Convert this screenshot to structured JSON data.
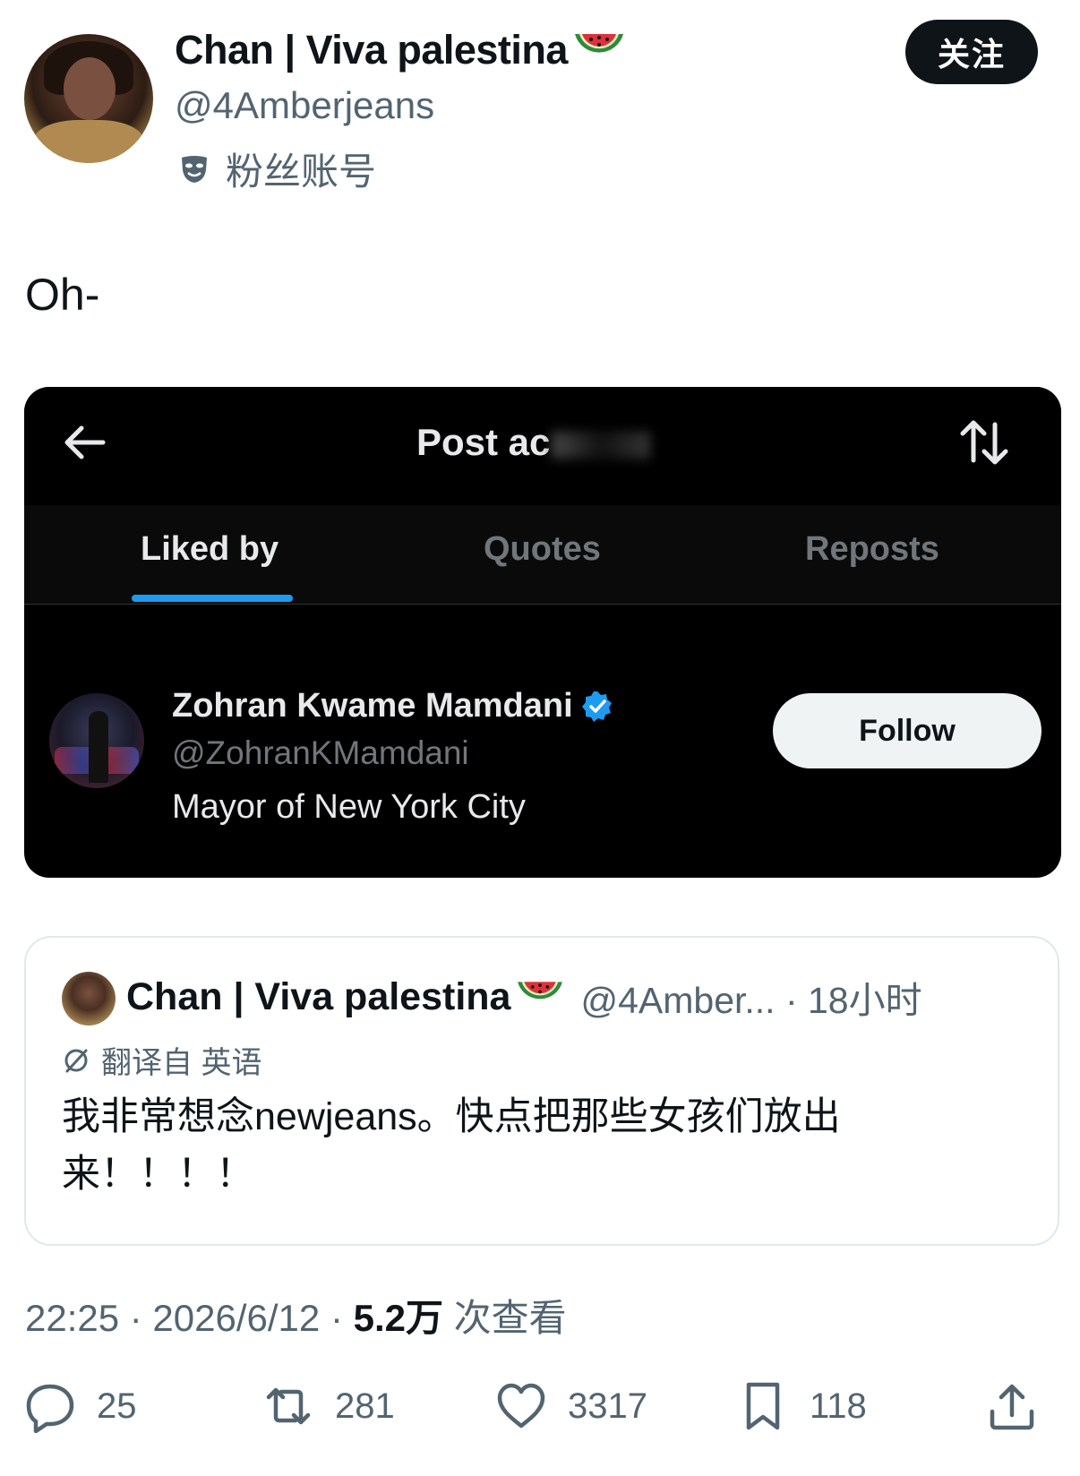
{
  "author": {
    "display_name": "Chan | Viva palestina",
    "handle": "@4Amberjeans",
    "account_label": "粉丝账号"
  },
  "follow_button": "关注",
  "tweet_text": "Oh-",
  "embedded": {
    "title": "Post ac",
    "tabs": [
      {
        "label": "Liked by",
        "active": true
      },
      {
        "label": "Quotes",
        "active": false
      },
      {
        "label": "Reposts",
        "active": false
      }
    ],
    "user": {
      "name": "Zohran Kwame Mamdani",
      "handle": "@ZohranKMamdani",
      "bio": "Mayor of New York City",
      "follow_label": "Follow"
    }
  },
  "quoted": {
    "name": "Chan | Viva palestina",
    "handle_time": "@4Amber... · 18小时",
    "translation_note": "翻译自 英语",
    "text": "我非常想念newjeans。快点把那些女孩们放出来！！！！"
  },
  "meta": {
    "time_date": "22:25 · 2026/6/12 · ",
    "views_count": "5.2万",
    "views_label": " 次查看"
  },
  "actions": {
    "replies": "25",
    "reposts": "281",
    "likes": "3317",
    "bookmarks": "118"
  },
  "colors": {
    "text": "#0f1419",
    "secondary": "#536471",
    "accent": "#1d9bf0",
    "dark_bg": "#000000"
  }
}
